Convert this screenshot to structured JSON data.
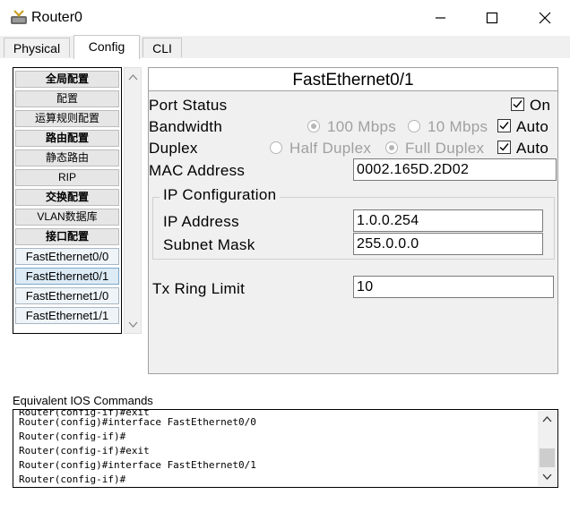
{
  "window": {
    "title": "Router0",
    "app_icon": "router-icon",
    "minimize_icon": "minimize-icon",
    "maximize_icon": "maximize-icon",
    "close_icon": "close-icon"
  },
  "tabs": [
    {
      "label": "Physical",
      "active": false
    },
    {
      "label": "Config",
      "active": true
    },
    {
      "label": "CLI",
      "active": false
    }
  ],
  "nav": {
    "items": [
      {
        "label": "全局配置",
        "type": "header"
      },
      {
        "label": "配置",
        "type": "item"
      },
      {
        "label": "运算规则配置",
        "type": "item"
      },
      {
        "label": "路由配置",
        "type": "header"
      },
      {
        "label": "静态路由",
        "type": "item"
      },
      {
        "label": "RIP",
        "type": "item"
      },
      {
        "label": "交换配置",
        "type": "header"
      },
      {
        "label": "VLAN数据库",
        "type": "item"
      },
      {
        "label": "接口配置",
        "type": "header"
      },
      {
        "label": "FastEthernet0/0",
        "type": "iface"
      },
      {
        "label": "FastEthernet0/1",
        "type": "iface",
        "selected": true
      },
      {
        "label": "FastEthernet1/0",
        "type": "iface"
      },
      {
        "label": "FastEthernet1/1",
        "type": "iface"
      }
    ]
  },
  "interface_panel": {
    "title": "FastEthernet0/1",
    "port_status": {
      "label": "Port Status",
      "on_label": "On",
      "on_checked": true
    },
    "bandwidth": {
      "label": "Bandwidth",
      "opt1": "100 Mbps",
      "opt1_checked": true,
      "opt2": "10 Mbps",
      "opt2_checked": false,
      "auto_label": "Auto",
      "auto_checked": true
    },
    "duplex": {
      "label": "Duplex",
      "opt1": "Half Duplex",
      "opt1_checked": false,
      "opt2": "Full Duplex",
      "opt2_checked": true,
      "auto_label": "Auto",
      "auto_checked": true
    },
    "mac": {
      "label": "MAC Address",
      "value": "0002.165D.2D02"
    },
    "ip_config": {
      "title": "IP Configuration",
      "ip_label": "IP Address",
      "ip_value": "1.0.0.254",
      "mask_label": "Subnet Mask",
      "mask_value": "255.0.0.0"
    },
    "tx_ring": {
      "label": "Tx Ring Limit",
      "value": "10"
    }
  },
  "ios": {
    "label": "Equivalent IOS Commands",
    "lines": [
      "Router(config)#interface FastEthernet0/0",
      "Router(config-if)#",
      "Router(config-if)#exit",
      "Router(config)#interface FastEthernet0/1",
      "Router(config-if)#"
    ]
  }
}
